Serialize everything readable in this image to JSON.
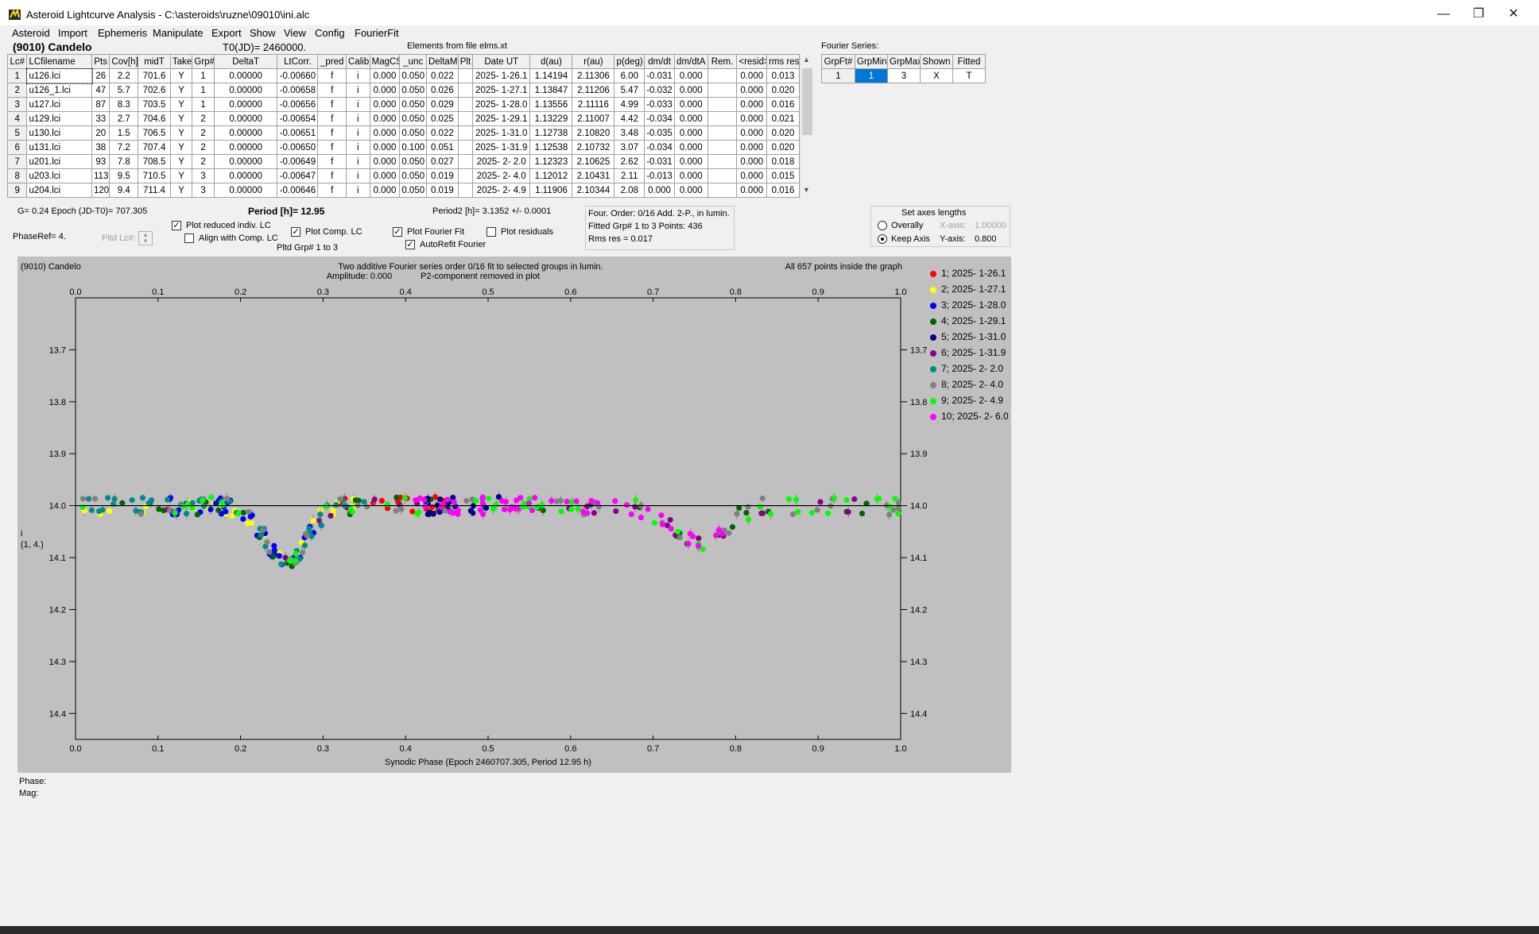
{
  "window": {
    "title": "Asteroid Lightcurve Analysis - C:\\asteroids\\ruzne\\09010\\ini.alc",
    "minimize": "—",
    "maximize": "❐",
    "close": "✕"
  },
  "menu": [
    "Asteroid",
    "Import",
    "Ephemeris",
    "Manipulate",
    "Export",
    "Show",
    "View",
    "Config",
    "FourierFit"
  ],
  "header": {
    "asteroid": "(9010) Candelo",
    "t0": "T0(JD)= 2460000.",
    "elements": "Elements from file elms.xt"
  },
  "lc_table": {
    "columns": [
      "Lc#",
      "LCfilename",
      "Pts",
      "Cov[h]",
      "midT",
      "Take",
      "Grp#",
      "DeltaT",
      "LtCorr.",
      "_pred",
      "Calib",
      "MagCS",
      "_unc",
      "DeltaM",
      "Plt",
      "Date UT",
      "d(au)",
      "r(au)",
      "p(deg)",
      "dm/dt",
      "dm/dtA",
      "Rem.",
      "<resid>",
      "rms res"
    ],
    "rows": [
      [
        "1",
        "u126.lci",
        "26",
        "2.2",
        "701.6",
        "Y",
        "1",
        "0.00000",
        "-0.00660",
        "f",
        "i",
        "0.000",
        "0.050",
        "0.022",
        "",
        "2025- 1-26.1",
        "1.14194",
        "2.11306",
        "6.00",
        "-0.031",
        "0.000",
        "",
        "0.000",
        "0.013"
      ],
      [
        "2",
        "u126_1.lci",
        "47",
        "5.7",
        "702.6",
        "Y",
        "1",
        "0.00000",
        "-0.00658",
        "f",
        "i",
        "0.000",
        "0.050",
        "0.026",
        "",
        "2025- 1-27.1",
        "1.13847",
        "2.11206",
        "5.47",
        "-0.032",
        "0.000",
        "",
        "0.000",
        "0.020"
      ],
      [
        "3",
        "u127.lci",
        "87",
        "8.3",
        "703.5",
        "Y",
        "1",
        "0.00000",
        "-0.00656",
        "f",
        "i",
        "0.000",
        "0.050",
        "0.029",
        "",
        "2025- 1-28.0",
        "1.13556",
        "2.11116",
        "4.99",
        "-0.033",
        "0.000",
        "",
        "0.000",
        "0.016"
      ],
      [
        "4",
        "u129.lci",
        "33",
        "2.7",
        "704.6",
        "Y",
        "2",
        "0.00000",
        "-0.00654",
        "f",
        "i",
        "0.000",
        "0.050",
        "0.025",
        "",
        "2025- 1-29.1",
        "1.13229",
        "2.11007",
        "4.42",
        "-0.034",
        "0.000",
        "",
        "0.000",
        "0.021"
      ],
      [
        "5",
        "u130.lci",
        "20",
        "1.5",
        "706.5",
        "Y",
        "2",
        "0.00000",
        "-0.00651",
        "f",
        "i",
        "0.000",
        "0.050",
        "0.022",
        "",
        "2025- 1-31.0",
        "1.12738",
        "2.10820",
        "3.48",
        "-0.035",
        "0.000",
        "",
        "0.000",
        "0.020"
      ],
      [
        "6",
        "u131.lci",
        "38",
        "7.2",
        "707.4",
        "Y",
        "2",
        "0.00000",
        "-0.00650",
        "f",
        "i",
        "0.000",
        "0.100",
        "0.051",
        "",
        "2025- 1-31.9",
        "1.12538",
        "2.10732",
        "3.07",
        "-0.034",
        "0.000",
        "",
        "0.000",
        "0.020"
      ],
      [
        "7",
        "u201.lci",
        "93",
        "7.8",
        "708.5",
        "Y",
        "2",
        "0.00000",
        "-0.00649",
        "f",
        "i",
        "0.000",
        "0.050",
        "0.027",
        "",
        "2025- 2- 2.0",
        "1.12323",
        "2.10625",
        "2.62",
        "-0.031",
        "0.000",
        "",
        "0.000",
        "0.018"
      ],
      [
        "8",
        "u203.lci",
        "113",
        "9.5",
        "710.5",
        "Y",
        "3",
        "0.00000",
        "-0.00647",
        "f",
        "i",
        "0.000",
        "0.050",
        "0.019",
        "",
        "2025- 2- 4.0",
        "1.12012",
        "2.10431",
        "2.11",
        "-0.013",
        "0.000",
        "",
        "0.000",
        "0.015"
      ],
      [
        "9",
        "u204.lci",
        "120",
        "9.4",
        "711.4",
        "Y",
        "3",
        "0.00000",
        "-0.00646",
        "f",
        "i",
        "0.000",
        "0.050",
        "0.019",
        "",
        "2025- 2- 4.9",
        "1.11906",
        "2.10344",
        "2.08",
        "0.000",
        "0.000",
        "",
        "0.000",
        "0.016"
      ]
    ]
  },
  "fourier_series": {
    "label": "Fourier Series:",
    "columns": [
      "GrpFt#",
      "GrpMin",
      "GrpMax",
      "Shown",
      "Fitted"
    ],
    "row": [
      "1",
      "1",
      "3",
      "X",
      "T"
    ]
  },
  "controls": {
    "g_epoch": "G= 0.24   Epoch (JD-T0)= 707.305",
    "period": "Period [h]= 12.95",
    "period2": "Period2 [h]= 3.1352 +/- 0.0001",
    "phaseref": "PhaseRef= 4.",
    "pltd_lc": "Pltd Lc#:",
    "plot_reduced": "Plot reduced indiv. LC",
    "align_comp": "Align with Comp. LC",
    "plot_comp": "Plot Comp. LC",
    "pltd_grp": "Pltd Grp#  1   to   3",
    "plot_fourier": "Plot Fourier Fit",
    "autorefit": "AutoRefit Fourier",
    "plot_residuals": "Plot residuals",
    "four_order": "Four. Order:  0/16   Add. 2-P., in lumin.",
    "fitted_grp": "Fitted Grp# 1 to 3     Points: 436",
    "rms_res": "Rms res      = 0.017",
    "axes_title": "Set axes lengths",
    "overally": "Overally",
    "keep_axis": "Keep Axis",
    "x_axis_label": "X-axis:",
    "x_axis_value": "1.00000",
    "y_axis_label": "Y-axis:",
    "y_axis_value": "0.800",
    "phase_readout": "Phase:",
    "mag_readout": "Mag:"
  },
  "colors": {
    "plot_bg": "#c0c0c0",
    "plot_frame": "#000000",
    "fourier_line": "#000000"
  },
  "chart_data": {
    "type": "scatter",
    "title": "(9010) Candelo",
    "subtitle_1": "Two additive Fourier series order 0/16 fit to selected groups in lumin.",
    "subtitle_2": "Amplitude: 0.000",
    "subtitle_3": "P2-component removed in plot",
    "points_note": "All 657 points inside the graph",
    "xlabel": "Synodic Phase (Epoch 2460707.305, Period 12.95 h)",
    "ylabel": "i",
    "ylabel_2": "(1, 4.)",
    "xlim": [
      0,
      1
    ],
    "ylim": [
      14.45,
      13.6
    ],
    "xticks": [
      0.0,
      0.1,
      0.2,
      0.3,
      0.4,
      0.5,
      0.6,
      0.7,
      0.8,
      0.9,
      1.0
    ],
    "yticks": [
      13.7,
      13.8,
      13.9,
      14.0,
      14.1,
      14.2,
      14.3,
      14.4
    ],
    "fit_level": 14.0,
    "legend_placement": "right",
    "series": [
      {
        "name": "1; 2025- 1-26.1",
        "color": "#ff0000",
        "phase_start": 0.31,
        "phase_end": 0.45
      },
      {
        "name": "2; 2025- 1-27.1",
        "color": "#ffff00",
        "phase_start": 0.0,
        "phase_end": 0.35
      },
      {
        "name": "3; 2025- 1-28.0",
        "color": "#0000ff",
        "phase_start": 0.11,
        "phase_end": 0.3
      },
      {
        "name": "4; 2025- 1-29.1",
        "color": "#006400",
        "phase_start": 0.0,
        "phase_end": 1.0
      },
      {
        "name": "5; 2025- 1-31.0",
        "color": "#00008b",
        "phase_start": 0.42,
        "phase_end": 0.52
      },
      {
        "name": "6; 2025- 1-31.9",
        "color": "#8b008b",
        "phase_start": 0.1,
        "phase_end": 0.96
      },
      {
        "name": "7; 2025- 2- 2.0",
        "color": "#008b8b",
        "phase_start": 0.0,
        "phase_end": 0.36
      },
      {
        "name": "8; 2025- 2- 4.0",
        "color": "#808080",
        "phase_start": 0.0,
        "phase_end": 1.0
      },
      {
        "name": "9; 2025- 2- 4.9",
        "color": "#00ff00",
        "phase_start": 0.0,
        "phase_end": 1.0
      },
      {
        "name": "10; 2025- 2- 6.0",
        "color": "#ff00ff",
        "phase_start": 0.4,
        "phase_end": 0.8
      }
    ]
  }
}
